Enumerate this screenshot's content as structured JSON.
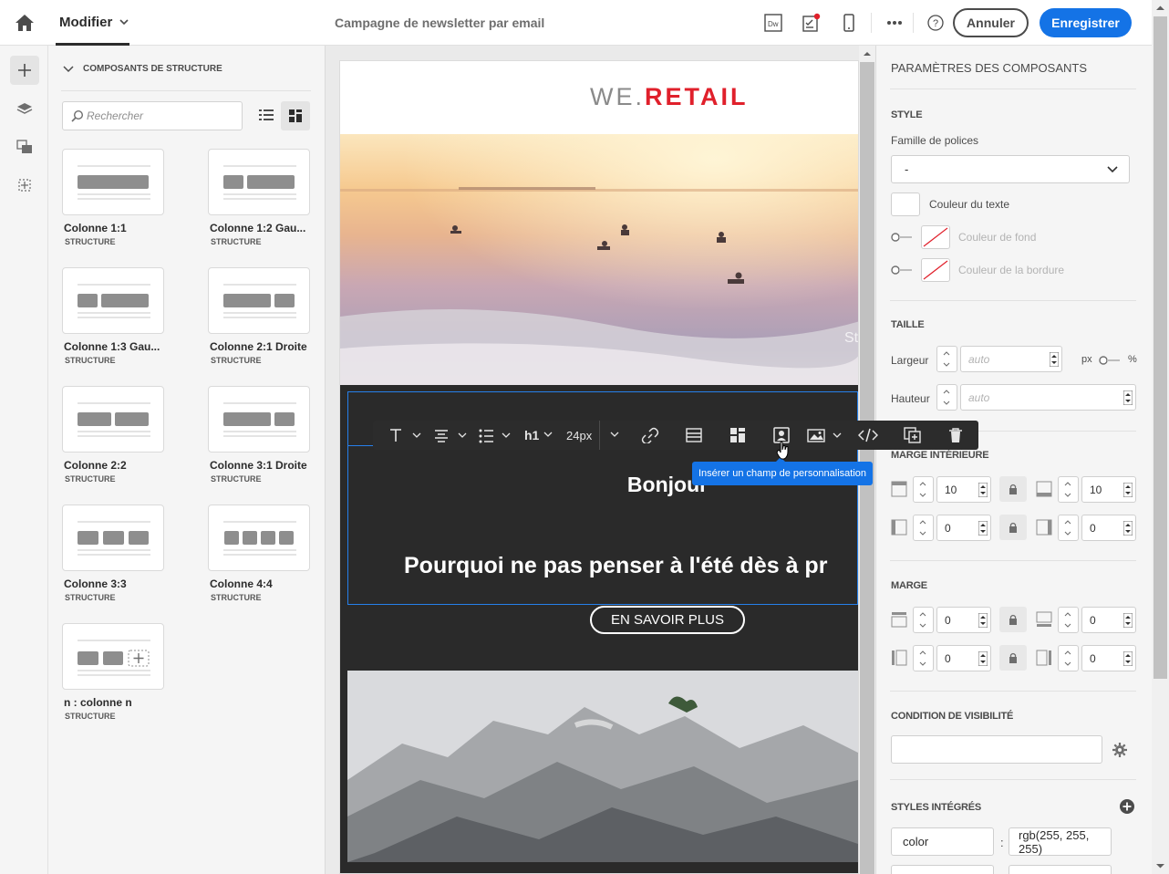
{
  "header": {
    "mode_label": "Modifier",
    "page_title": "Campagne de newsletter par email",
    "cancel_label": "Annuler",
    "save_label": "Enregistrer",
    "dw_icon_text": "Dw"
  },
  "components": {
    "section_title": "COMPOSANTS DE STRUCTURE",
    "search_placeholder": "Rechercher",
    "items": [
      {
        "title": "Colonne 1:1",
        "subtitle": "STRUCTURE"
      },
      {
        "title": "Colonne 1:2 Gau...",
        "subtitle": "STRUCTURE"
      },
      {
        "title": "Colonne 1:3 Gau...",
        "subtitle": "STRUCTURE"
      },
      {
        "title": "Colonne 2:1 Droite",
        "subtitle": "STRUCTURE"
      },
      {
        "title": "Colonne 2:2",
        "subtitle": "STRUCTURE"
      },
      {
        "title": "Colonne 3:1 Droite",
        "subtitle": "STRUCTURE"
      },
      {
        "title": "Colonne 3:3",
        "subtitle": "STRUCTURE"
      },
      {
        "title": "Colonne 4:4",
        "subtitle": "STRUCTURE"
      },
      {
        "title": "n : colonne n",
        "subtitle": "STRUCTURE"
      }
    ]
  },
  "email": {
    "logo_we": "WE.",
    "logo_retail": "RETAIL",
    "hero_overlay": "St",
    "greeting": "Bonjour",
    "headline": "Pourquoi ne pas penser à l'été dès à pr",
    "cta": "EN SAVOIR PLUS"
  },
  "toolbar": {
    "heading": "h1",
    "font_size": "24px",
    "tooltip": "Insérer un champ de personnalisation"
  },
  "props": {
    "title": "PARAMÈTRES DES COMPOSANTS",
    "style_section": "STYLE",
    "font_family_label": "Famille de polices",
    "font_family_value": "-",
    "text_color_label": "Couleur du texte",
    "bg_color_label": "Couleur de fond",
    "border_color_label": "Couleur de la bordure",
    "size_section": "TAILLE",
    "width_label": "Largeur",
    "width_placeholder": "auto",
    "unit_px": "px",
    "unit_pct": "%",
    "height_label": "Hauteur",
    "height_placeholder": "auto",
    "padding_section": "MARGE INTÉRIEURE",
    "padding_top": "10",
    "padding_bottom": "10",
    "padding_left": "0",
    "padding_right": "0",
    "margin_section": "MARGE",
    "margin_top": "0",
    "margin_bottom": "0",
    "margin_left": "0",
    "margin_right": "0",
    "visibility_section": "CONDITION DE VISIBILITÉ",
    "inline_section": "STYLES INTÉGRÉS",
    "inline_prop": "color",
    "inline_sep": ":",
    "inline_value": "rgb(255, 255, 255)"
  },
  "colors": {
    "accent": "#1473e6",
    "selection": "#2680eb",
    "logo_red": "#e0202b",
    "dark_block": "#2a2a2a"
  }
}
